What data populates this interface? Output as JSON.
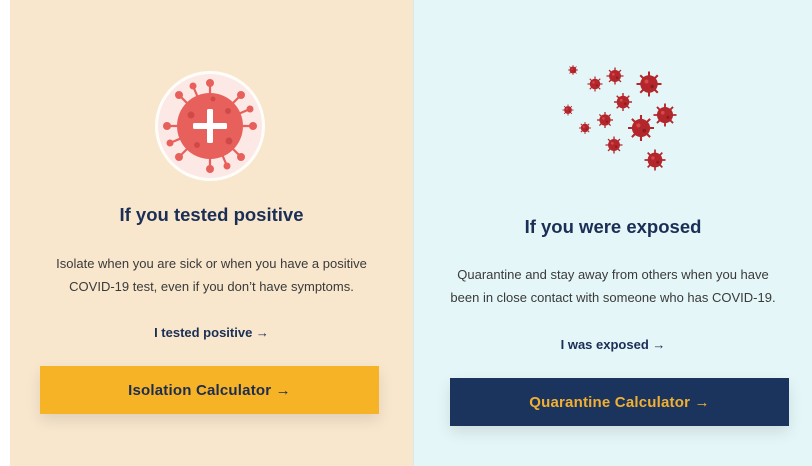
{
  "positive_card": {
    "icon": "virus-plus-icon",
    "heading": "If you tested positive",
    "description_line1": "Isolate when you are sick or when you have a positive",
    "description_line2": "COVID-19 test, even if you don’t have symptoms.",
    "link_label": "I tested positive →",
    "button_label": "Isolation Calculator →",
    "colors": {
      "background": "#f8e7cd",
      "button": "#f7b326",
      "button_text": "#1e2d4e",
      "virus": "#e8605c"
    }
  },
  "exposed_card": {
    "icon": "virus-cluster-icon",
    "heading": "If you were exposed",
    "description_line1": "Quarantine and stay away from others when you have",
    "description_line2": "been in close contact with someone who has COVID-19.",
    "link_label": "I was exposed →",
    "button_label": "Quarantine Calculator →",
    "colors": {
      "background": "#e4f6f7",
      "button": "#1a345e",
      "button_text": "#f2b033",
      "virus": "#b3262b"
    }
  }
}
